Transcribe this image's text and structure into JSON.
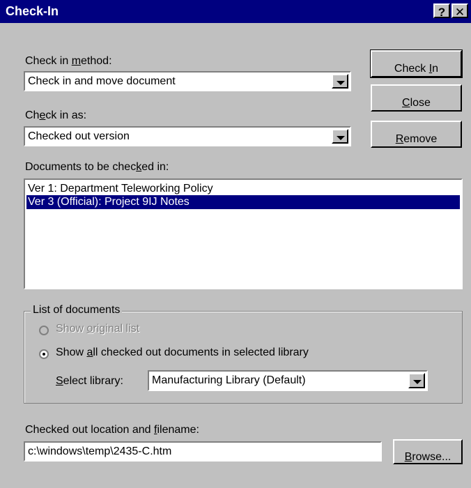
{
  "window": {
    "title": "Check-In",
    "help_button": "?",
    "close_button": "✕"
  },
  "check_in_method": {
    "label_before": "Check in ",
    "label_mnemonic": "m",
    "label_after": "ethod:",
    "value": "Check in and move document"
  },
  "check_in_as": {
    "label_before": "Ch",
    "label_mnemonic": "e",
    "label_after": "ck in as:",
    "value": "Checked out version"
  },
  "buttons": {
    "check_in": {
      "before": "Check ",
      "mnemonic": "I",
      "after": "n"
    },
    "close": {
      "before": "",
      "mnemonic": "C",
      "after": "lose"
    },
    "remove": {
      "before": "",
      "mnemonic": "R",
      "after": "emove"
    },
    "browse": {
      "before": "",
      "mnemonic": "B",
      "after": "rowse..."
    }
  },
  "documents": {
    "label_before": "Documents to be chec",
    "label_mnemonic": "k",
    "label_after": "ed in:",
    "items": [
      {
        "text": "Ver  1: Department Teleworking Policy",
        "selected": false
      },
      {
        "text": "Ver  3 (Official): Project 9IJ Notes",
        "selected": true
      }
    ]
  },
  "list_of_documents": {
    "title": "List of documents",
    "show_original": {
      "before": "Show ",
      "mnemonic": "o",
      "after": "riginal list",
      "enabled": false,
      "checked": false
    },
    "show_all": {
      "before": "Show ",
      "mnemonic": "a",
      "after": "ll checked out documents in selected library",
      "enabled": true,
      "checked": true
    },
    "select_library": {
      "label_before": "",
      "label_mnemonic": "S",
      "label_after": "elect library:",
      "value": "Manufacturing Library  (Default)"
    }
  },
  "location": {
    "label_before": "Checked out location and ",
    "label_mnemonic": "f",
    "label_after": "ilename:",
    "value": "c:\\windows\\temp\\2435-C.htm"
  },
  "colors": {
    "titlebar": "#000080",
    "face": "#c0c0c0",
    "selection": "#000080"
  }
}
